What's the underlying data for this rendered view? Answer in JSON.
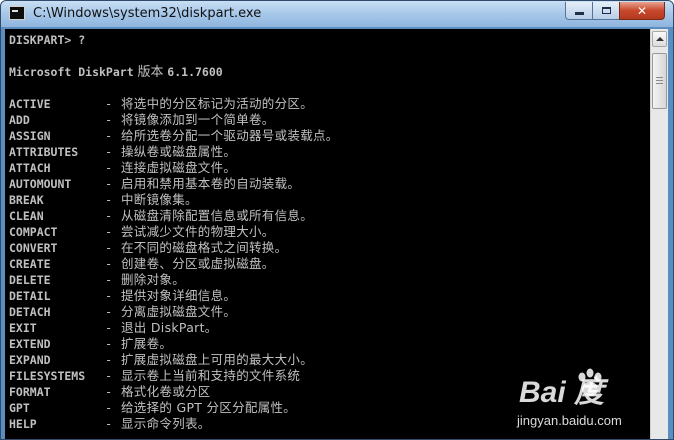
{
  "window": {
    "title": "C:\\Windows\\system32\\diskpart.exe"
  },
  "console": {
    "prompt": "DISKPART> ?",
    "banner_prefix": "Microsoft DiskPart",
    "banner_version_word": "版本",
    "banner_version": "6.1.7600",
    "commands": [
      {
        "name": "ACTIVE",
        "dash": "-",
        "desc": "将选中的分区标记为活动的分区。"
      },
      {
        "name": "ADD",
        "dash": "-",
        "desc": "将镜像添加到一个简单卷。"
      },
      {
        "name": "ASSIGN",
        "dash": "-",
        "desc": "给所选卷分配一个驱动器号或装载点。"
      },
      {
        "name": "ATTRIBUTES",
        "dash": "-",
        "desc": "操纵卷或磁盘属性。"
      },
      {
        "name": "ATTACH",
        "dash": "-",
        "desc": "连接虚拟磁盘文件。"
      },
      {
        "name": "AUTOMOUNT",
        "dash": "-",
        "desc": "启用和禁用基本卷的自动装载。"
      },
      {
        "name": "BREAK",
        "dash": "-",
        "desc": "中断镜像集。"
      },
      {
        "name": "CLEAN",
        "dash": "-",
        "desc": "从磁盘清除配置信息或所有信息。"
      },
      {
        "name": "COMPACT",
        "dash": "-",
        "desc": "尝试减少文件的物理大小。"
      },
      {
        "name": "CONVERT",
        "dash": "-",
        "desc": "在不同的磁盘格式之间转换。"
      },
      {
        "name": "CREATE",
        "dash": "-",
        "desc": "创建卷、分区或虚拟磁盘。"
      },
      {
        "name": "DELETE",
        "dash": "-",
        "desc": "删除对象。"
      },
      {
        "name": "DETAIL",
        "dash": "-",
        "desc": "提供对象详细信息。"
      },
      {
        "name": "DETACH",
        "dash": "-",
        "desc": "分离虚拟磁盘文件。"
      },
      {
        "name": "EXIT",
        "dash": "-",
        "desc": "退出 DiskPart。"
      },
      {
        "name": "EXTEND",
        "dash": "-",
        "desc": "扩展卷。"
      },
      {
        "name": "EXPAND",
        "dash": "-",
        "desc": "扩展虚拟磁盘上可用的最大大小。"
      },
      {
        "name": "FILESYSTEMS",
        "dash": "-",
        "desc": "显示卷上当前和支持的文件系统"
      },
      {
        "name": "FORMAT",
        "dash": "-",
        "desc": "格式化卷或分区"
      },
      {
        "name": "GPT",
        "dash": "-",
        "desc": "给选择的 GPT 分区分配属性。"
      },
      {
        "name": "HELP",
        "dash": "-",
        "desc": "显示命令列表。"
      }
    ]
  },
  "watermark": {
    "logo": "Bai  度",
    "url": "jingyan.baidu.com"
  },
  "colors": {
    "console_bg": "#000000",
    "console_text": "#c0c0c0",
    "titlebar": "#a9c9ea",
    "close_button": "#c9482c"
  }
}
